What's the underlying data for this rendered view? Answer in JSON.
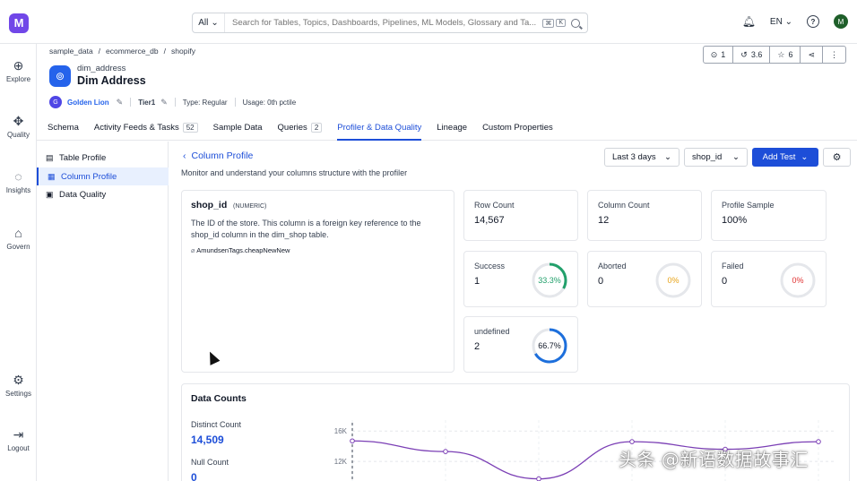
{
  "topbar": {
    "logo": "M",
    "search_scope": "All",
    "search_placeholder": "Search for Tables, Topics, Dashboards, Pipelines, ML Models, Glossary and Ta...",
    "kbd1": "⌘",
    "kbd2": "K",
    "language": "EN",
    "help": "?",
    "avatar": "M"
  },
  "nav": [
    {
      "label": "Explore",
      "icon": "explore-icon"
    },
    {
      "label": "Quality",
      "icon": "quality-icon"
    },
    {
      "label": "Insights",
      "icon": "insights-icon"
    },
    {
      "label": "Govern",
      "icon": "govern-icon"
    },
    {
      "label": "Settings",
      "icon": "settings-icon"
    },
    {
      "label": "Logout",
      "icon": "logout-icon"
    }
  ],
  "breadcrumb": [
    "sample_data",
    "/",
    "ecommerce_db",
    "/",
    "shopify"
  ],
  "entity": {
    "fqn": "dim_address",
    "title": "Dim Address",
    "owner_initial": "G",
    "owner": "Golden Lion",
    "tier": "Tier1",
    "type": "Type: Regular",
    "usage": "Usage: 0th pctile"
  },
  "actions": {
    "alerts": "1",
    "version": "3.6",
    "stars": "6"
  },
  "tabs": [
    {
      "label": "Schema",
      "count": ""
    },
    {
      "label": "Activity Feeds & Tasks",
      "count": "52"
    },
    {
      "label": "Sample Data",
      "count": ""
    },
    {
      "label": "Queries",
      "count": "2"
    },
    {
      "label": "Profiler & Data Quality",
      "count": ""
    },
    {
      "label": "Lineage",
      "count": ""
    },
    {
      "label": "Custom Properties",
      "count": ""
    }
  ],
  "profile_menu": [
    "Table Profile",
    "Column Profile",
    "Data Quality"
  ],
  "column_profile": {
    "title": "Column Profile",
    "subtitle": "Monitor and understand your columns structure with the profiler",
    "range": "Last 3 days",
    "column_select": "shop_id",
    "add_test": "Add Test"
  },
  "column": {
    "name": "shop_id",
    "type": "(NUMERIC)",
    "description": "The ID of the store. This column is a foreign key reference to the shop_id column in the dim_shop table.",
    "tag": "AmundsenTags.cheapNewNew"
  },
  "stats": [
    {
      "label": "Row Count",
      "value": "14,567"
    },
    {
      "label": "Column Count",
      "value": "12"
    },
    {
      "label": "Profile Sample",
      "value": "100%"
    }
  ],
  "results": [
    {
      "label": "Success",
      "value": "1",
      "percent": "33.3%",
      "fraction": 0.333,
      "color": "#22a06b"
    },
    {
      "label": "Aborted",
      "value": "0",
      "percent": "0%",
      "fraction": 0,
      "color": "#e8a317"
    },
    {
      "label": "Failed",
      "value": "0",
      "percent": "0%",
      "fraction": 0,
      "color": "#e03131"
    },
    {
      "label": "undefined",
      "value": "2",
      "percent": "66.7%",
      "fraction": 0.667,
      "color": "#1d6fdc"
    }
  ],
  "data_counts": {
    "title": "Data Counts",
    "distinct_label": "Distinct Count",
    "distinct_value": "14,509",
    "null_label": "Null Count",
    "null_value": "0"
  },
  "chart_data": {
    "type": "line",
    "y_ticks": [
      "16K",
      "12K"
    ],
    "ylim": [
      8000,
      16500
    ],
    "series": [
      {
        "values": [
          14700,
          13300,
          9700,
          14600,
          13600,
          14600
        ]
      }
    ]
  },
  "watermark": "头条 @新语数据故事汇",
  "colors": {
    "accent": "#1d4ed8",
    "brand": "#7147e8"
  }
}
